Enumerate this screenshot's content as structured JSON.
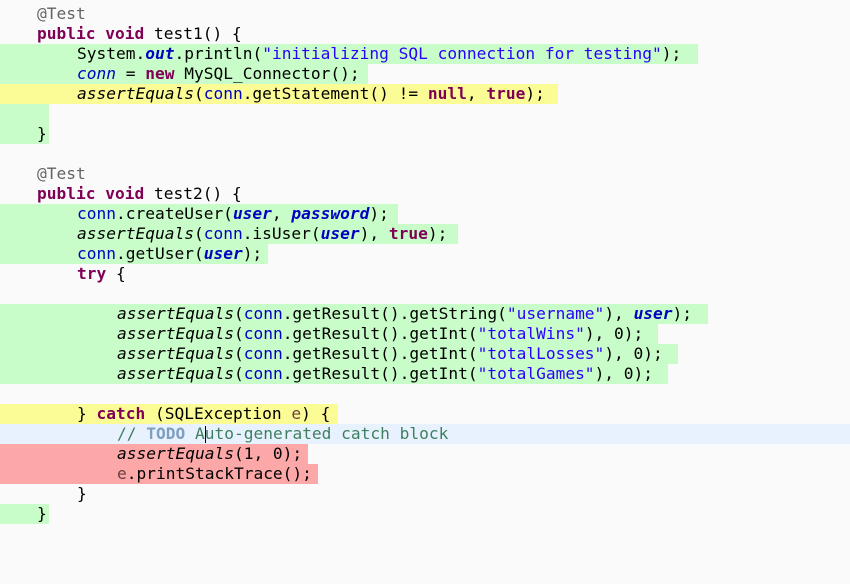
{
  "editor": {
    "colors": {
      "covered": "#c8fcc8",
      "partial": "#fcfc96",
      "missed": "#fca8a8",
      "current_line": "#e8f2fe",
      "background": "#fafafa"
    },
    "lines": [
      {
        "coverage": "none",
        "tokens": [
          "@Test"
        ]
      },
      {
        "coverage": "none",
        "tokens": [
          "public",
          " ",
          "void",
          " test1() {"
        ]
      },
      {
        "coverage": "covered",
        "tokens": [
          "System.",
          "out",
          ".println(",
          "\"initializing SQL connection for testing\"",
          ");"
        ]
      },
      {
        "coverage": "covered",
        "tokens": [
          "conn",
          " = ",
          "new",
          " MySQL_Connector();"
        ]
      },
      {
        "coverage": "partial",
        "tokens": [
          "assertEquals",
          "(",
          "conn",
          ".getStatement() != ",
          "null",
          ", ",
          "true",
          ");"
        ]
      },
      {
        "coverage": "covered",
        "tokens": []
      },
      {
        "coverage": "covered",
        "tokens": [
          "}"
        ]
      },
      {
        "coverage": "none",
        "tokens": []
      },
      {
        "coverage": "none",
        "tokens": [
          "@Test"
        ]
      },
      {
        "coverage": "none",
        "tokens": [
          "public",
          " ",
          "void",
          " test2() {"
        ]
      },
      {
        "coverage": "covered",
        "tokens": [
          "conn",
          ".createUser(",
          "user",
          ", ",
          "password",
          ");"
        ]
      },
      {
        "coverage": "covered",
        "tokens": [
          "assertEquals",
          "(",
          "conn",
          ".isUser(",
          "user",
          "), ",
          "true",
          ");"
        ]
      },
      {
        "coverage": "covered",
        "tokens": [
          "conn",
          ".getUser(",
          "user",
          ");"
        ]
      },
      {
        "coverage": "none",
        "tokens": [
          "try",
          " {"
        ]
      },
      {
        "coverage": "none",
        "tokens": []
      },
      {
        "coverage": "covered",
        "tokens": [
          "assertEquals",
          "(",
          "conn",
          ".getResult().getString(",
          "\"username\"",
          "), ",
          "user",
          ");"
        ]
      },
      {
        "coverage": "covered",
        "tokens": [
          "assertEquals",
          "(",
          "conn",
          ".getResult().getInt(",
          "\"totalWins\"",
          "), 0);"
        ]
      },
      {
        "coverage": "covered",
        "tokens": [
          "assertEquals",
          "(",
          "conn",
          ".getResult().getInt(",
          "\"totalLosses\"",
          "), 0);"
        ]
      },
      {
        "coverage": "covered",
        "tokens": [
          "assertEquals",
          "(",
          "conn",
          ".getResult().getInt(",
          "\"totalGames\"",
          "), 0);"
        ]
      },
      {
        "coverage": "none",
        "tokens": []
      },
      {
        "coverage": "partial",
        "tokens": [
          "} ",
          "catch",
          " (SQLException ",
          "e",
          ") {"
        ]
      },
      {
        "coverage": "current",
        "tokens": [
          "// ",
          "TODO",
          " A",
          "uto-generated catch block"
        ]
      },
      {
        "coverage": "missed",
        "tokens": [
          "assertEquals",
          "(1, 0);"
        ]
      },
      {
        "coverage": "missed",
        "tokens": [
          "e",
          ".printStackTrace();"
        ]
      },
      {
        "coverage": "none",
        "tokens": [
          "}"
        ]
      },
      {
        "coverage": "covered",
        "tokens": [
          "}"
        ]
      }
    ]
  }
}
